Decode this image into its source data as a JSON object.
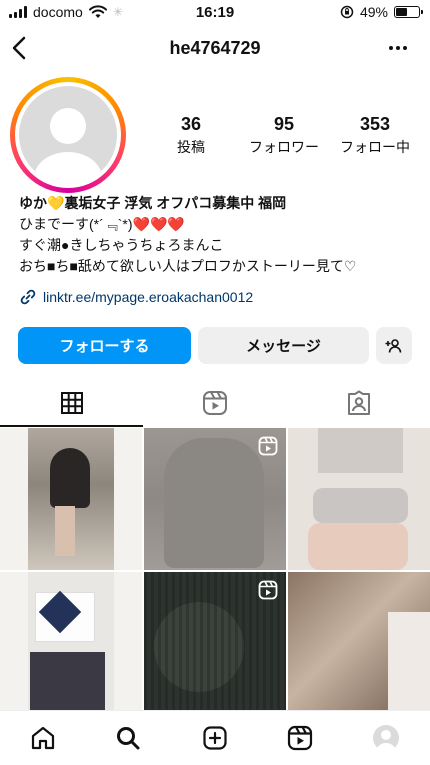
{
  "status": {
    "carrier": "docomo",
    "time": "16:19",
    "battery_text": "49%",
    "battery_level": 0.49
  },
  "header": {
    "username": "he4764729"
  },
  "profile": {
    "stats": [
      {
        "value": "36",
        "label": "投稿"
      },
      {
        "value": "95",
        "label": "フォロワー"
      },
      {
        "value": "353",
        "label": "フォロー中"
      }
    ],
    "bio": {
      "name_prefix": "ゆか",
      "name_rest": "裏垢女子 浮気 オフパコ募集中 福岡",
      "line1": "ひまでーす(*´﹃`*)",
      "hearts": "❤️❤️❤️",
      "line2": "すぐ潮●きしちゃうちょろまんこ",
      "line3": "おち■ち■舐めて欲しい人はプロフかストーリー見て♡"
    },
    "link": "linktr.ee/mypage.eroakachan0012"
  },
  "actions": {
    "follow_label": "フォローする",
    "message_label": "メッセージ"
  },
  "colors": {
    "primary": "#0095f6",
    "link": "#00376b",
    "button_bg": "#efefef"
  },
  "grid": {
    "posts": [
      {
        "type": "photo"
      },
      {
        "type": "reel"
      },
      {
        "type": "photo"
      },
      {
        "type": "photo"
      },
      {
        "type": "reel"
      },
      {
        "type": "photo"
      }
    ]
  }
}
